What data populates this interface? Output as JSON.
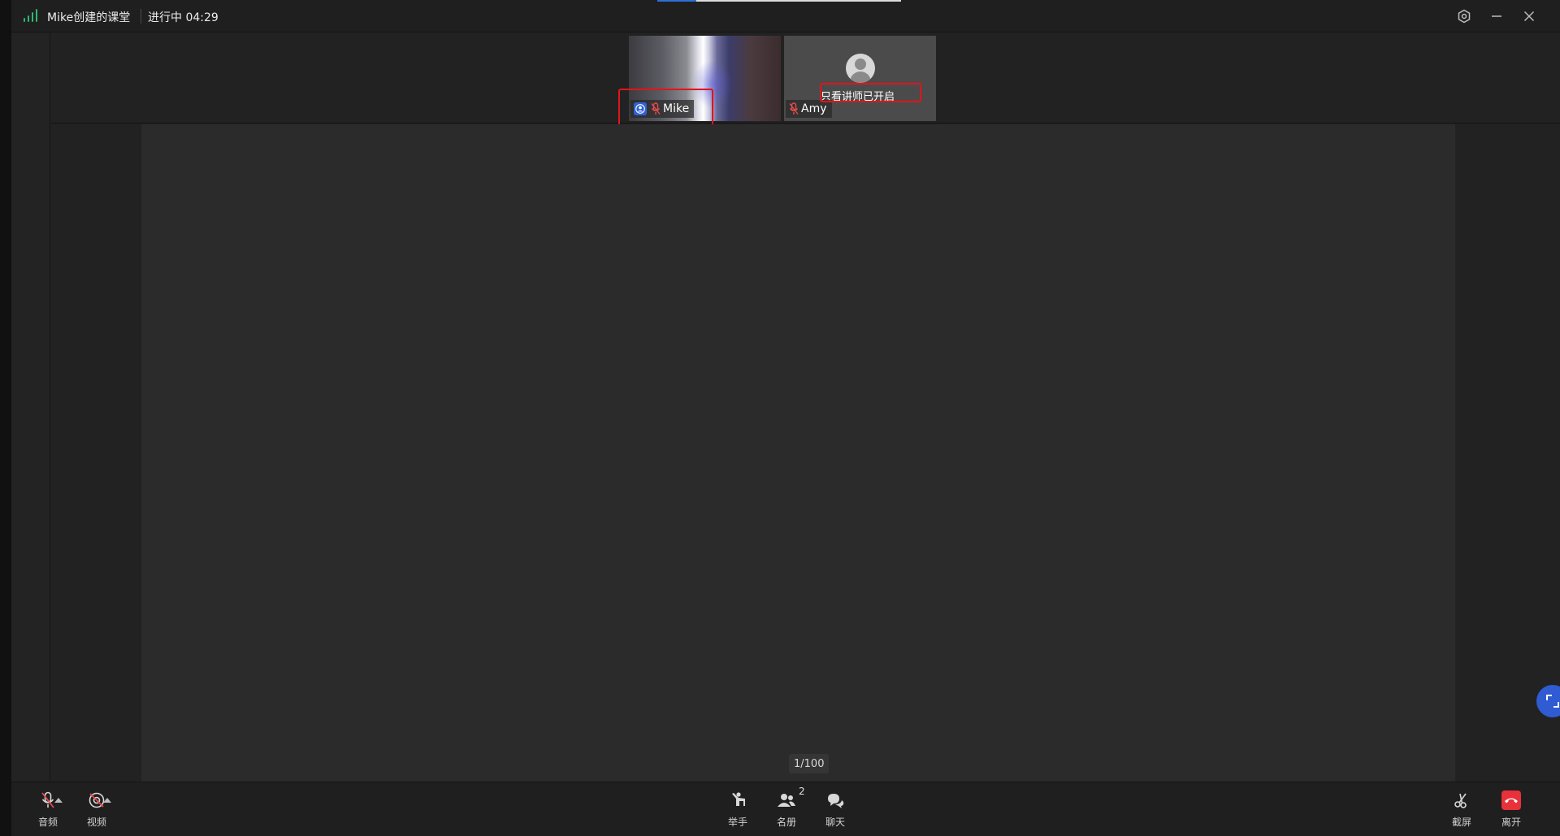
{
  "window": {
    "room_title": "Mike创建的课堂",
    "session_status": "进行中 04:29",
    "progress_fraction": 0.16
  },
  "icons": {
    "signal": "signal-strength-icon",
    "settings": "settings-icon",
    "minimize": "minimize-icon",
    "close": "close-icon",
    "host": "host-badge-icon",
    "mic_off": "mic-off-icon",
    "avatar": "default-avatar-icon",
    "fullscreen": "fullscreen-icon"
  },
  "videos": [
    {
      "name": "Mike",
      "role": "host",
      "mic": "off",
      "camera": "on"
    },
    {
      "name": "Amy",
      "mic": "off",
      "camera": "off",
      "overlay_text": "只看讲师已开启"
    }
  ],
  "board": {
    "page_indicator": "1/100"
  },
  "toolbar": {
    "audio_label": "音频",
    "video_label": "视频",
    "raise_hand_label": "举手",
    "roster_label": "名册",
    "roster_count": "2",
    "chat_label": "聊天",
    "screenshot_label": "截屏",
    "leave_label": "离开"
  },
  "colors": {
    "accent_blue": "#2f5bd3",
    "signal_green": "#2fb871",
    "highlight_red": "#e3141a",
    "leave_red": "#e8313a",
    "mic_off_red": "#e64b4b"
  }
}
